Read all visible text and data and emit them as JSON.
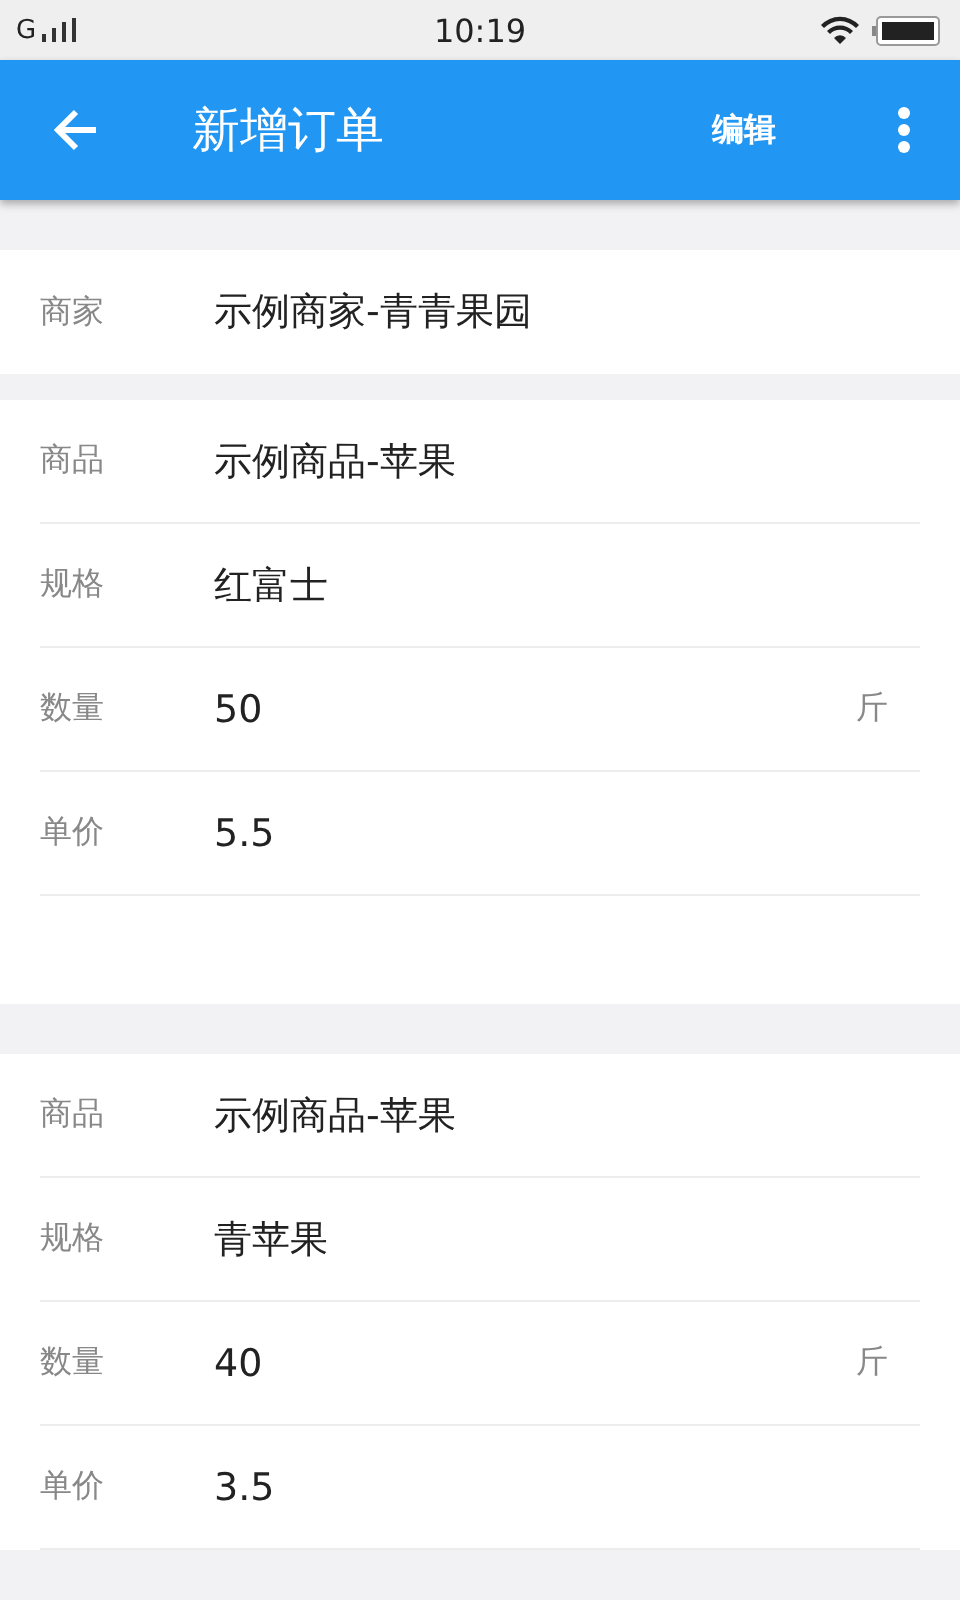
{
  "status_bar": {
    "carrier": "G",
    "time": "10:19"
  },
  "app_bar": {
    "title": "新增订单",
    "action": "编辑"
  },
  "merchant": {
    "label": "商家",
    "value": "示例商家-青青果园"
  },
  "orders": [
    {
      "rows": [
        {
          "label": "商品",
          "value": "示例商品-苹果"
        },
        {
          "label": "规格",
          "value": "红富士"
        },
        {
          "label": "数量",
          "value": "50",
          "unit": "斤"
        },
        {
          "label": "单价",
          "value": "5.5"
        }
      ]
    },
    {
      "rows": [
        {
          "label": "商品",
          "value": "示例商品-苹果"
        },
        {
          "label": "规格",
          "value": "青苹果"
        },
        {
          "label": "数量",
          "value": "40",
          "unit": "斤"
        },
        {
          "label": "单价",
          "value": "3.5"
        }
      ]
    }
  ]
}
